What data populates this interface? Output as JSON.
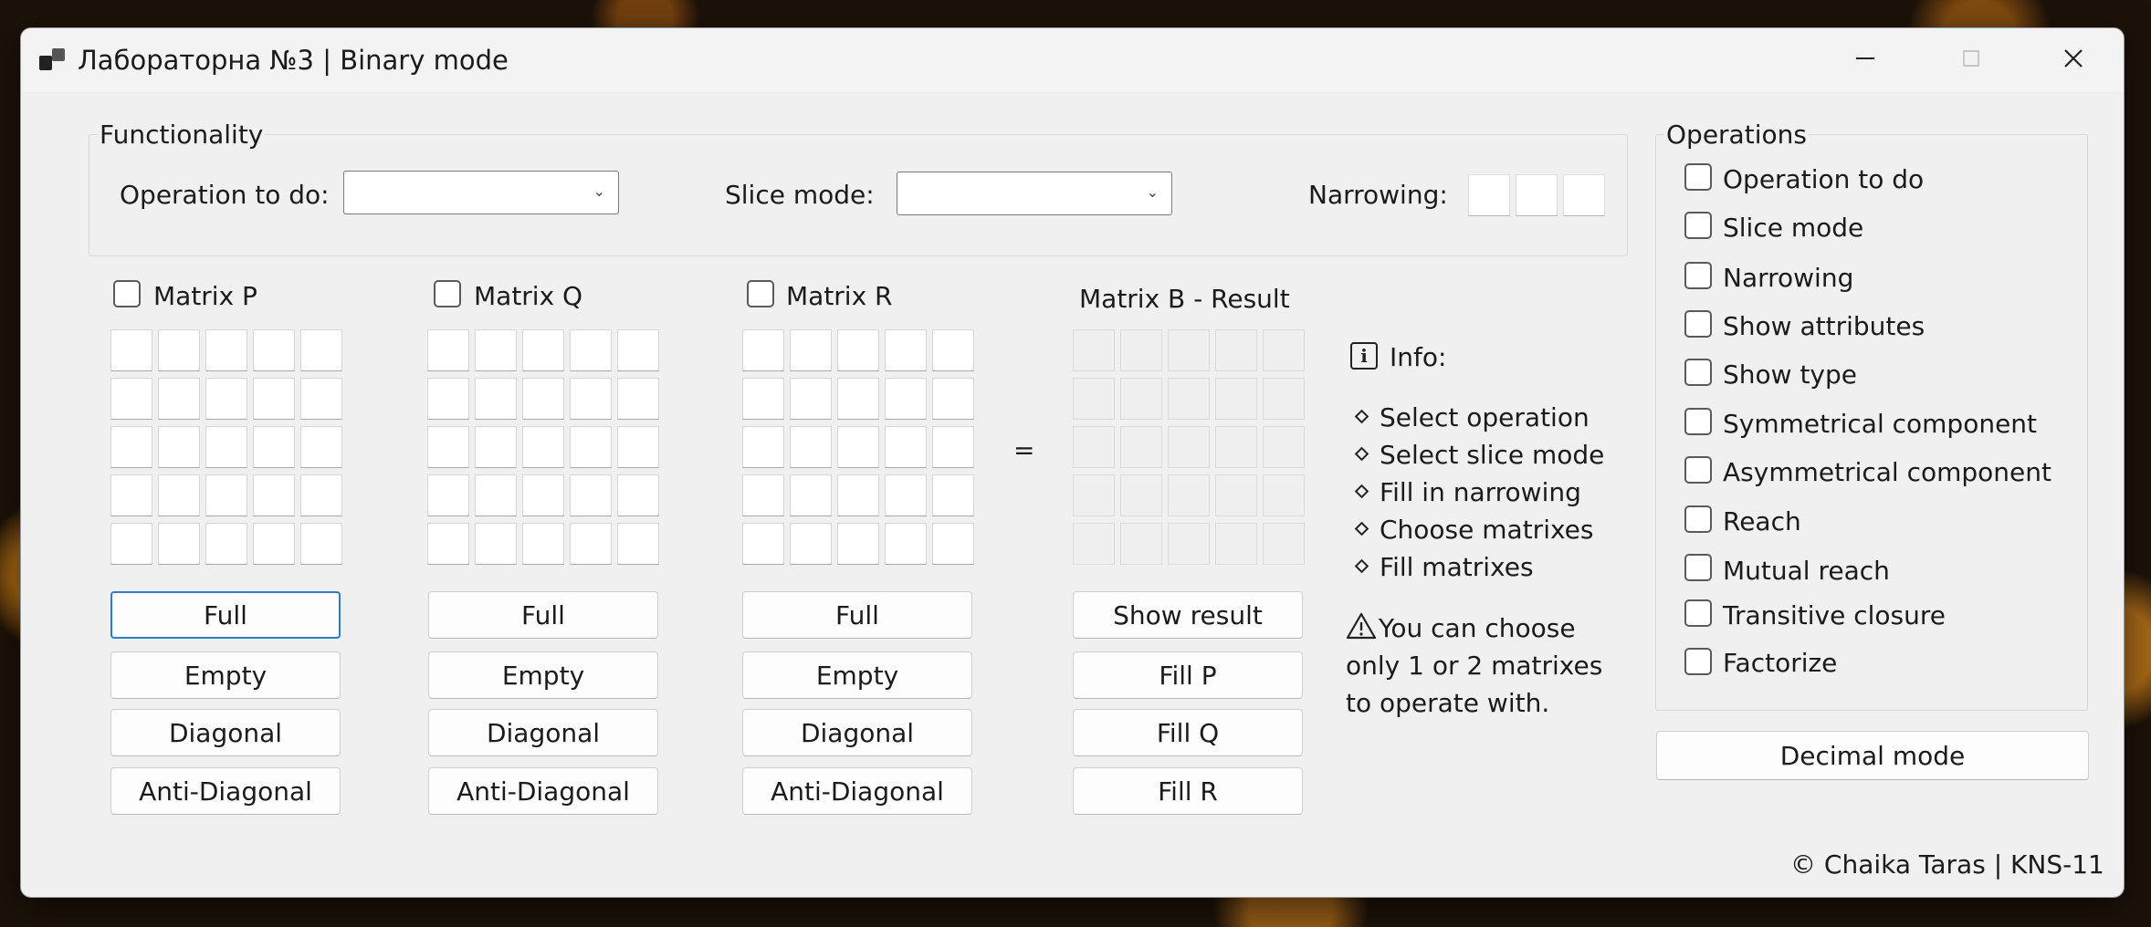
{
  "window": {
    "title": "Лабораторна №3 | Binary mode"
  },
  "icons": {
    "app": "app-icon",
    "minimize": "minimize-icon",
    "maximize": "maximize-icon",
    "close": "close-icon",
    "info": "info-icon",
    "warning": "warning-icon",
    "chevron": "chevron-down-icon"
  },
  "functionality": {
    "legend": "Functionality",
    "operation_label": "Operation to do:",
    "operation_value": "",
    "slice_label": "Slice mode:",
    "slice_value": "",
    "narrowing_label": "Narrowing:",
    "narrowing_values": [
      "",
      "",
      ""
    ]
  },
  "matrices": [
    {
      "label": "Matrix P",
      "checked": false,
      "buttons": [
        "Full",
        "Empty",
        "Diagonal",
        "Anti-Diagonal"
      ]
    },
    {
      "label": "Matrix Q",
      "checked": false,
      "buttons": [
        "Full",
        "Empty",
        "Diagonal",
        "Anti-Diagonal"
      ]
    },
    {
      "label": "Matrix R",
      "checked": false,
      "buttons": [
        "Full",
        "Empty",
        "Diagonal",
        "Anti-Diagonal"
      ]
    }
  ],
  "equals": "=",
  "result": {
    "label": "Matrix B - Result",
    "buttons": [
      "Show result",
      "Fill P",
      "Fill Q",
      "Fill R"
    ]
  },
  "info": {
    "title": "Info:",
    "steps": [
      "Select operation",
      "Select slice mode",
      "Fill in narrowing",
      "Choose matrixes",
      "Fill matrixes"
    ],
    "warning": "You can choose only 1 or 2 matrixes to operate with."
  },
  "operations": {
    "legend": "Operations",
    "items": [
      {
        "label": "Operation to do",
        "checked": false
      },
      {
        "label": "Slice mode",
        "checked": false
      },
      {
        "label": "Narrowing",
        "checked": false
      },
      {
        "label": "Show attributes",
        "checked": false
      },
      {
        "label": "Show type",
        "checked": false
      },
      {
        "label": "Symmetrical component",
        "checked": false
      },
      {
        "label": "Asymmetrical component",
        "checked": false
      },
      {
        "label": "Reach",
        "checked": false
      },
      {
        "label": "Mutual reach",
        "checked": false
      },
      {
        "label": "Transitive closure",
        "checked": false
      },
      {
        "label": "Factorize",
        "checked": false
      }
    ]
  },
  "decimal_mode_button": "Decimal mode",
  "footer": "© Chaika Taras | KNS-11",
  "colors": {
    "window_bg": "#f0f0f0",
    "focus_border": "#2f7ad6",
    "cell_bg": "#ffffff"
  }
}
